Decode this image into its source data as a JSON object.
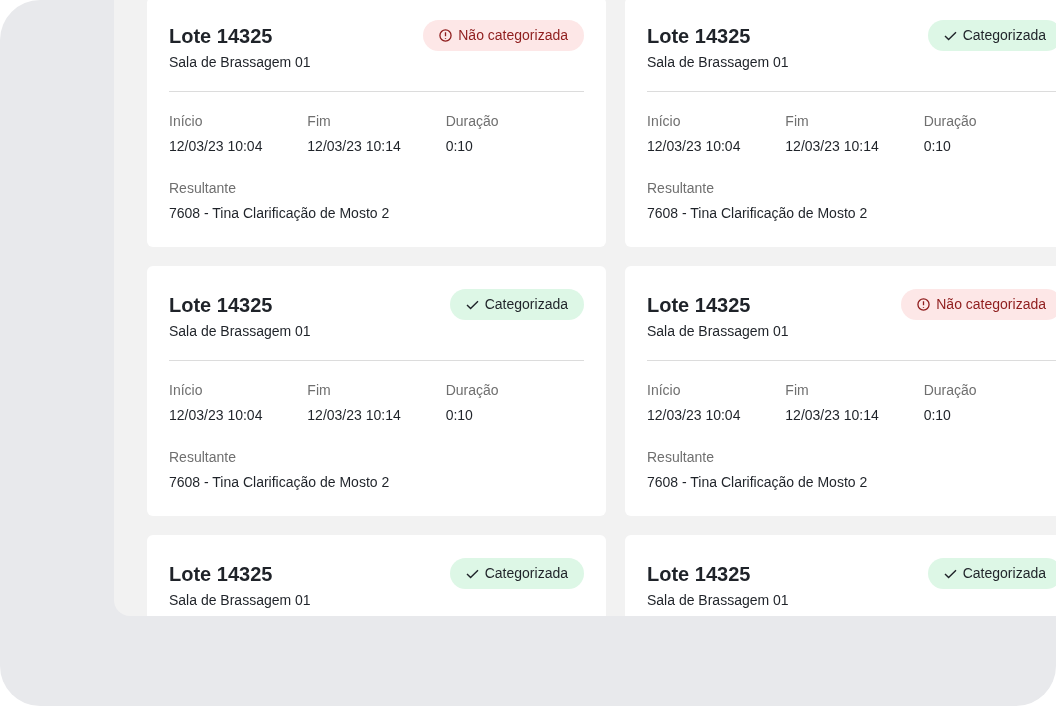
{
  "cards": [
    {
      "title": "Lote 14325",
      "subtitle": "Sala de Brassagem 01",
      "status": {
        "kind": "uncategorized",
        "label": "Não categorizada"
      },
      "fields": [
        {
          "label": "Início",
          "value": "12/03/23 10:04"
        },
        {
          "label": "Fim",
          "value": "12/03/23 10:14"
        },
        {
          "label": "Duração",
          "value": "0:10"
        }
      ],
      "result": {
        "label": "Resultante",
        "value": "7608 - Tina Clarificação de Mosto 2"
      }
    },
    {
      "title": "Lote 14325",
      "subtitle": "Sala de Brassagem 01",
      "status": {
        "kind": "categorized",
        "label": "Categorizada"
      },
      "fields": [
        {
          "label": "Início",
          "value": "12/03/23 10:04"
        },
        {
          "label": "Fim",
          "value": "12/03/23 10:14"
        },
        {
          "label": "Duração",
          "value": "0:10"
        }
      ],
      "result": {
        "label": "Resultante",
        "value": "7608 - Tina Clarificação de Mosto 2"
      }
    },
    {
      "title": "Lote 14325",
      "subtitle": "Sala de Brassagem 01",
      "status": {
        "kind": "categorized",
        "label": "Categorizada"
      },
      "fields": [
        {
          "label": "Início",
          "value": "12/03/23 10:04"
        },
        {
          "label": "Fim",
          "value": "12/03/23 10:14"
        },
        {
          "label": "Duração",
          "value": "0:10"
        }
      ],
      "result": {
        "label": "Resultante",
        "value": "7608 - Tina Clarificação de Mosto 2"
      }
    },
    {
      "title": "Lote 14325",
      "subtitle": "Sala de Brassagem 01",
      "status": {
        "kind": "uncategorized",
        "label": "Não categorizada"
      },
      "fields": [
        {
          "label": "Início",
          "value": "12/03/23 10:04"
        },
        {
          "label": "Fim",
          "value": "12/03/23 10:14"
        },
        {
          "label": "Duração",
          "value": "0:10"
        }
      ],
      "result": {
        "label": "Resultante",
        "value": "7608 - Tina Clarificação de Mosto 2"
      }
    },
    {
      "title": "Lote 14325",
      "subtitle": "Sala de Brassagem 01",
      "status": {
        "kind": "categorized",
        "label": "Categorizada"
      }
    },
    {
      "title": "Lote 14325",
      "subtitle": "Sala de Brassagem 01",
      "status": {
        "kind": "categorized",
        "label": "Categorizada"
      }
    }
  ]
}
